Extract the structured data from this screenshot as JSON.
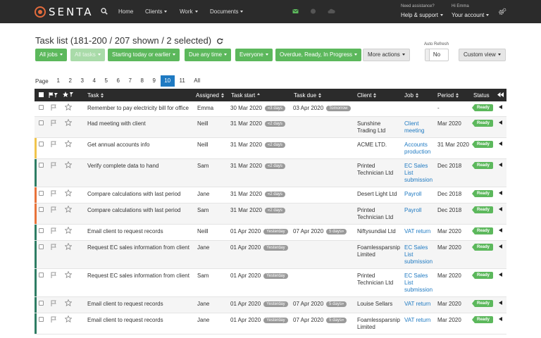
{
  "header": {
    "logo_text": "SENTA",
    "nav": [
      {
        "label": "Home",
        "caret": false
      },
      {
        "label": "Clients",
        "caret": true
      },
      {
        "label": "Work",
        "caret": true
      },
      {
        "label": "Documents",
        "caret": true
      }
    ],
    "assist_label": "Need assistance?",
    "help_link": "Help & support",
    "greeting": "Hi Emma",
    "account_link": "Your account",
    "icon_colors": {
      "mail": "#5cb85c",
      "globe": "#555555",
      "cloud": "#555555"
    }
  },
  "page": {
    "title": "Task list (181-200 / 207 shown / 2 selected)"
  },
  "filters": {
    "buttons": [
      "All jobs",
      "All tasks",
      "Starting today or earlier",
      "Due any time",
      "Everyone",
      "Overdue, Ready, In Progress"
    ],
    "more_actions": "More actions",
    "auto_refresh_label": "Auto Refresh",
    "auto_refresh_value": "No",
    "custom_view": "Custom view"
  },
  "pager": {
    "label": "Page",
    "pages": [
      "1",
      "2",
      "3",
      "4",
      "5",
      "6",
      "7",
      "8",
      "9",
      "10",
      "11",
      "All"
    ],
    "active": "10"
  },
  "table": {
    "headers": {
      "task": "Task",
      "assigned": "Assigned",
      "task_start": "Task start",
      "task_due": "Task due",
      "client": "Client",
      "job": "Job",
      "period": "Period",
      "status": "Status"
    },
    "rows": [
      {
        "task": "Remember to pay electricity bill for office",
        "assigned": "Emma",
        "start": "30 Mar 2020",
        "start_badge": "«3 days",
        "due": "03 Apr 2020",
        "due_badge": "Tomorrow",
        "client": "",
        "job": "",
        "period": "-",
        "status": "Ready",
        "stripe": ""
      },
      {
        "task": "Had meeting with client",
        "assigned": "Neill",
        "start": "31 Mar 2020",
        "start_badge": "«2 days",
        "due": "",
        "due_badge": "",
        "client": "Sunshine Trading Ltd",
        "job": "Client meeting",
        "period": "Mar 2020",
        "status": "Ready",
        "stripe": ""
      },
      {
        "task": "Get annual accounts info",
        "assigned": "Neill",
        "start": "31 Mar 2020",
        "start_badge": "«2 days",
        "due": "",
        "due_badge": "",
        "client": "ACME LTD.",
        "job": "Accounts production",
        "period": "31 Mar 2020",
        "status": "Ready",
        "stripe": "#f0c44c"
      },
      {
        "task": "Verify complete data to hand",
        "assigned": "Sam",
        "start": "31 Mar 2020",
        "start_badge": "«2 days",
        "due": "",
        "due_badge": "",
        "client": "Printed Technician Ltd",
        "job": "EC Sales List submission",
        "period": "Dec 2018",
        "status": "Ready",
        "stripe": "#2e7d64"
      },
      {
        "task": "Compare calculations with last period",
        "assigned": "Jane",
        "start": "31 Mar 2020",
        "start_badge": "«2 days",
        "due": "",
        "due_badge": "",
        "client": "Desert Light Ltd",
        "job": "Payroll",
        "period": "Dec 2018",
        "status": "Ready",
        "stripe": "#e8733a"
      },
      {
        "task": "Compare calculations with last period",
        "assigned": "Sam",
        "start": "31 Mar 2020",
        "start_badge": "«2 days",
        "due": "",
        "due_badge": "",
        "client": "Printed Technician Ltd",
        "job": "Payroll",
        "period": "Dec 2018",
        "status": "Ready",
        "stripe": "#e8733a"
      },
      {
        "task": "Email client to request records",
        "assigned": "Neill",
        "start": "01 Apr 2020",
        "start_badge": "Yesterday",
        "due": "07 Apr 2020",
        "due_badge": "5 days»",
        "client": "Niftysundial Ltd",
        "job": "VAT return",
        "period": "Mar 2020",
        "status": "Ready",
        "stripe": "#2e7d64"
      },
      {
        "task": "Request EC sales information from client",
        "assigned": "Jane",
        "start": "01 Apr 2020",
        "start_badge": "Yesterday",
        "due": "",
        "due_badge": "",
        "client": "Foamlessparsnip Limited",
        "job": "EC Sales List submission",
        "period": "Mar 2020",
        "status": "Ready",
        "stripe": "#2e7d64"
      },
      {
        "task": "Request EC sales information from client",
        "assigned": "Sam",
        "start": "01 Apr 2020",
        "start_badge": "Yesterday",
        "due": "",
        "due_badge": "",
        "client": "Printed Technician Ltd",
        "job": "EC Sales List submission",
        "period": "Mar 2020",
        "status": "Ready",
        "stripe": "#2e7d64"
      },
      {
        "task": "Email client to request records",
        "assigned": "Jane",
        "start": "01 Apr 2020",
        "start_badge": "Yesterday",
        "due": "07 Apr 2020",
        "due_badge": "5 days»",
        "client": "Louise Sellars",
        "job": "VAT return",
        "period": "Mar 2020",
        "status": "Ready",
        "stripe": "#2e7d64"
      },
      {
        "task": "Email client to request records",
        "assigned": "Jane",
        "start": "01 Apr 2020",
        "start_badge": "Yesterday",
        "due": "07 Apr 2020",
        "due_badge": "5 days»",
        "client": "Foamlessparsnip Limited",
        "job": "VAT return",
        "period": "Mar 2020",
        "status": "Ready",
        "stripe": "#2e7d64"
      }
    ]
  }
}
